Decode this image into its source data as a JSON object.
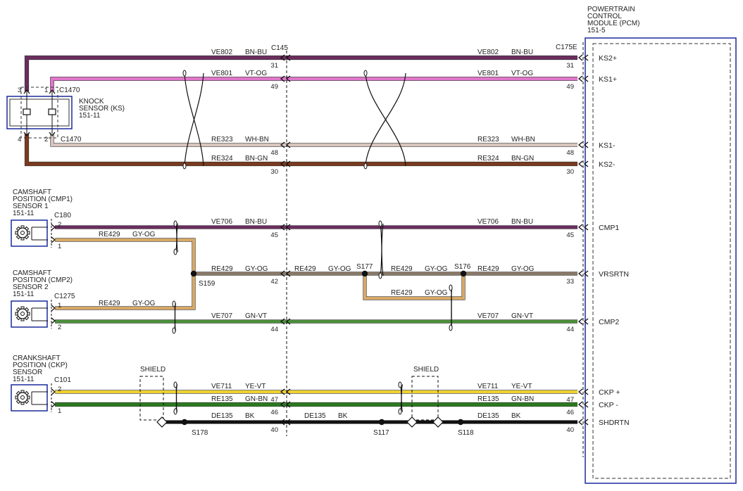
{
  "pcm": {
    "title_lines": [
      "POWERTRAIN",
      "CONTROL",
      "MODULE (PCM)",
      "151-5"
    ],
    "connector": "C175E"
  },
  "inline_connector": "C145",
  "components": [
    {
      "id": "ks",
      "lines": [
        "KNOCK",
        "SENSOR (KS)",
        "151-11"
      ]
    },
    {
      "id": "cmp1",
      "lines": [
        "CAMSHAFT",
        "POSITION (CMP1)",
        "SENSOR 1",
        "151-11"
      ]
    },
    {
      "id": "cmp2",
      "lines": [
        "CAMSHAFT",
        "POSITION (CMP2)",
        "SENSOR 2",
        "151-11"
      ]
    },
    {
      "id": "ckp",
      "lines": [
        "CRANKSHAFT",
        "POSITION (CKP)",
        "SENSOR",
        "151-11"
      ]
    }
  ],
  "pcm_signals": [
    "KS2+",
    "KS1+",
    "KS1-",
    "KS2-",
    "CMP1",
    "VRSRTN",
    "CMP2",
    "CKP +",
    "CKP -",
    "SHDRTN"
  ],
  "wire_labels": [
    {
      "circuit": "VE802",
      "color": "BN-BU"
    },
    {
      "circuit": "VE801",
      "color": "VT-OG"
    },
    {
      "circuit": "RE323",
      "color": "WH-BN"
    },
    {
      "circuit": "RE324",
      "color": "BN-GN"
    },
    {
      "circuit": "VE706",
      "color": "BN-BU"
    },
    {
      "circuit": "RE429",
      "color": "GY-OG"
    },
    {
      "circuit": "VE707",
      "color": "GN-VT"
    },
    {
      "circuit": "VE711",
      "color": "YE-VT"
    },
    {
      "circuit": "RE135",
      "color": "GN-BN"
    },
    {
      "circuit": "DE135",
      "color": "BK"
    }
  ],
  "connectors": [
    "C1470",
    "C180",
    "C1275",
    "C101"
  ],
  "splices": [
    "S159",
    "S177",
    "S176",
    "S178",
    "S117",
    "S118"
  ],
  "shield_label": "SHIELD",
  "pins": {
    "ks_left": [
      "3",
      "1",
      "4",
      "2"
    ],
    "c145": [
      "31",
      "49",
      "48",
      "30",
      "45",
      "42",
      "44",
      "47",
      "46",
      "40"
    ],
    "pcm": [
      "31",
      "49",
      "48",
      "30",
      "45",
      "33",
      "44",
      "47",
      "46",
      "40"
    ],
    "sensor": [
      "2",
      "1",
      "1",
      "2",
      "2",
      "1"
    ]
  },
  "colors": {
    "bn_bu": "#6b2d5e",
    "vt_og": "#e077c9",
    "wh_bn": "#d8c5bd",
    "bn_gn": "#7a3a1f",
    "gy_og": "#8b7966",
    "gy_og_light": "#d7a866",
    "gn_vt": "#4b8f3a",
    "ye_vt": "#efd22f",
    "gn_bn": "#2c7a21",
    "bk": "#111111",
    "box": "#1a2a9c"
  }
}
